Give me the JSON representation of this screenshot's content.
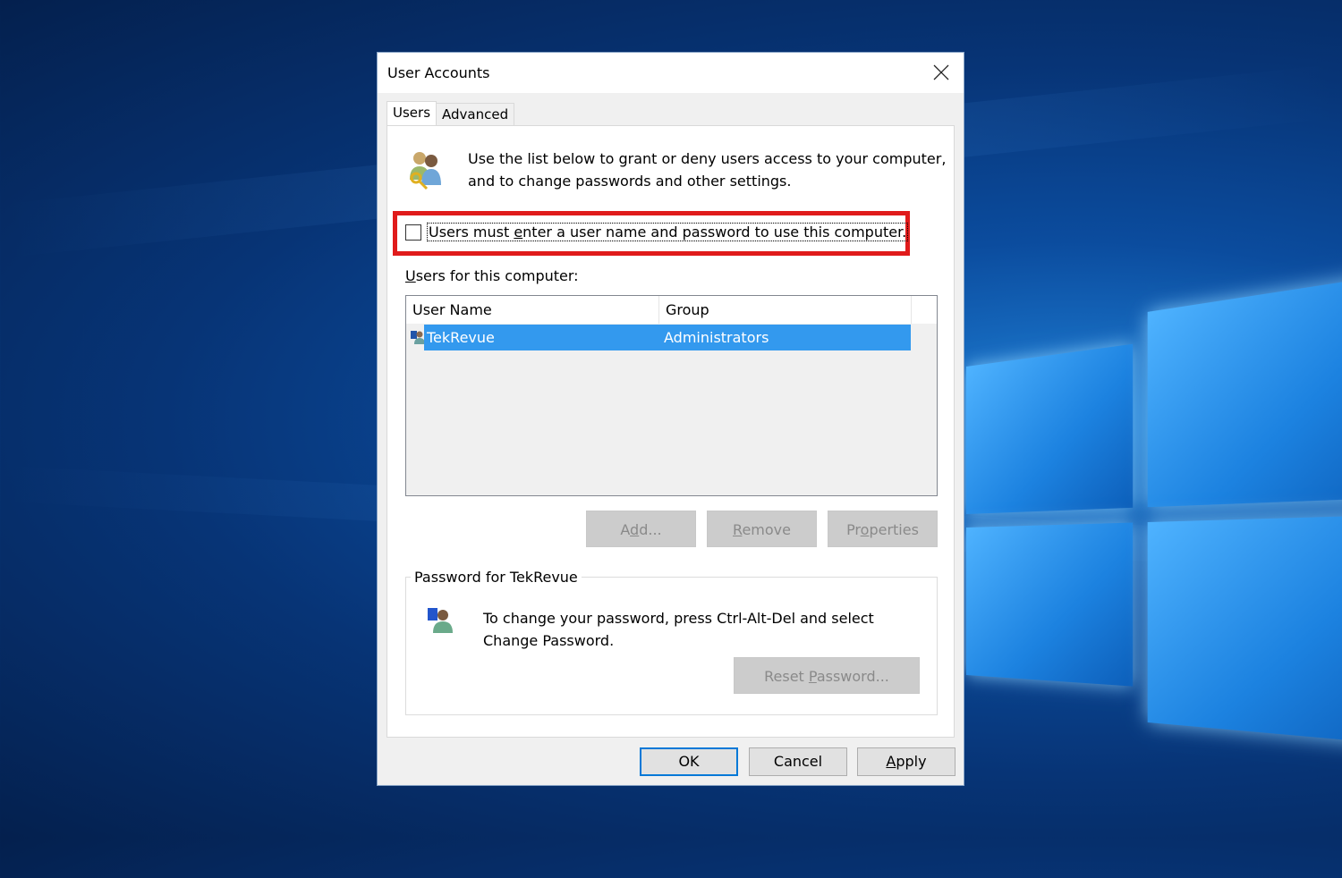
{
  "dialog": {
    "title": "User Accounts",
    "close_label": "Close",
    "tabs": [
      {
        "label": "Users",
        "active": true
      },
      {
        "label": "Advanced",
        "active": false
      }
    ],
    "intro_line1": "Use the list below to grant or deny users access to your computer,",
    "intro_line2": "and to change passwords and other settings.",
    "require_login": {
      "label_pre": "Users must ",
      "label_accel": "e",
      "label_post": "nter a user name and password to use this computer.",
      "checked": false,
      "highlight_color": "#e01b1b"
    },
    "users_label_accel": "U",
    "users_label_rest": "sers for this computer:",
    "users_table": {
      "columns": [
        "User Name",
        "Group"
      ],
      "rows": [
        {
          "user_name": "TekRevue",
          "group": "Administrators",
          "selected": true
        }
      ]
    },
    "list_buttons": {
      "add": {
        "pre": "A",
        "accel": "d",
        "post": "d..."
      },
      "remove": {
        "pre": "",
        "accel": "R",
        "post": "emove"
      },
      "properties": {
        "pre": "Pr",
        "accel": "o",
        "post": "perties"
      }
    },
    "password_group": {
      "title": "Password for TekRevue",
      "text_line1": "To change your password, press Ctrl-Alt-Del and select",
      "text_line2": "Change Password.",
      "reset": {
        "pre": "Reset ",
        "accel": "P",
        "post": "assword..."
      }
    },
    "footer": {
      "ok": "OK",
      "cancel": "Cancel",
      "apply_accel": "A",
      "apply_rest": "pply"
    },
    "colors": {
      "selection": "#3399ee",
      "default_button_border": "#0078d7"
    }
  }
}
